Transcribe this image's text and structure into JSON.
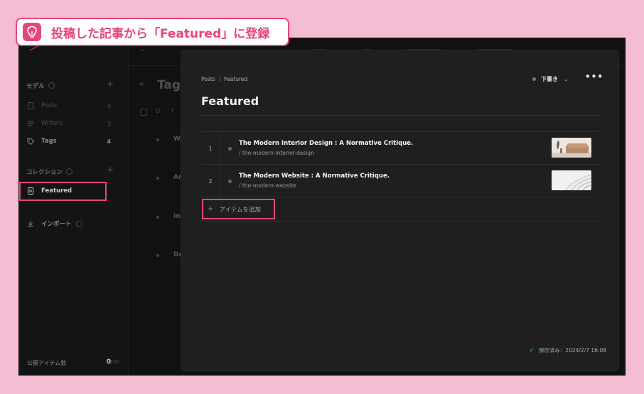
{
  "caption": {
    "text": "投稿した記事から「Featured」に登録"
  },
  "sidebar": {
    "models_label": "モデル",
    "models": [
      {
        "label": "Posts",
        "count": "3"
      },
      {
        "label": "Writers",
        "count": "3"
      },
      {
        "label": "Tags",
        "count": "4"
      }
    ],
    "collections_label": "コレクション",
    "collections": [
      {
        "label": "Featured"
      }
    ],
    "import_label": "インポート",
    "published_label": "公開アイテム数",
    "published_count": "0",
    "published_max": "/ 100"
  },
  "background": {
    "title": "Tags",
    "header_cells": [
      "D",
      "T"
    ],
    "rows": [
      "W",
      "Ar",
      "Int",
      "De"
    ]
  },
  "modal": {
    "breadcrumb": {
      "root": "Posts",
      "separator": "/",
      "current": "Featured"
    },
    "status_label": "下書き",
    "more_label": "•••",
    "title": "Featured",
    "items": [
      {
        "index": "1",
        "title": "The Modern Interior Design : A Normative Critique.",
        "slug": "/ the-modern-interior-design"
      },
      {
        "index": "2",
        "title": "The Modern Website : A Normative Critique.",
        "slug": "/ the-modern-website"
      }
    ],
    "add_item_label": "アイテムを追加",
    "saved_label": "保存済み：2024/2/7 16:08"
  },
  "colors": {
    "accent": "#e5457e",
    "background": "#f5bdd3",
    "saved_check": "#34c77b"
  }
}
